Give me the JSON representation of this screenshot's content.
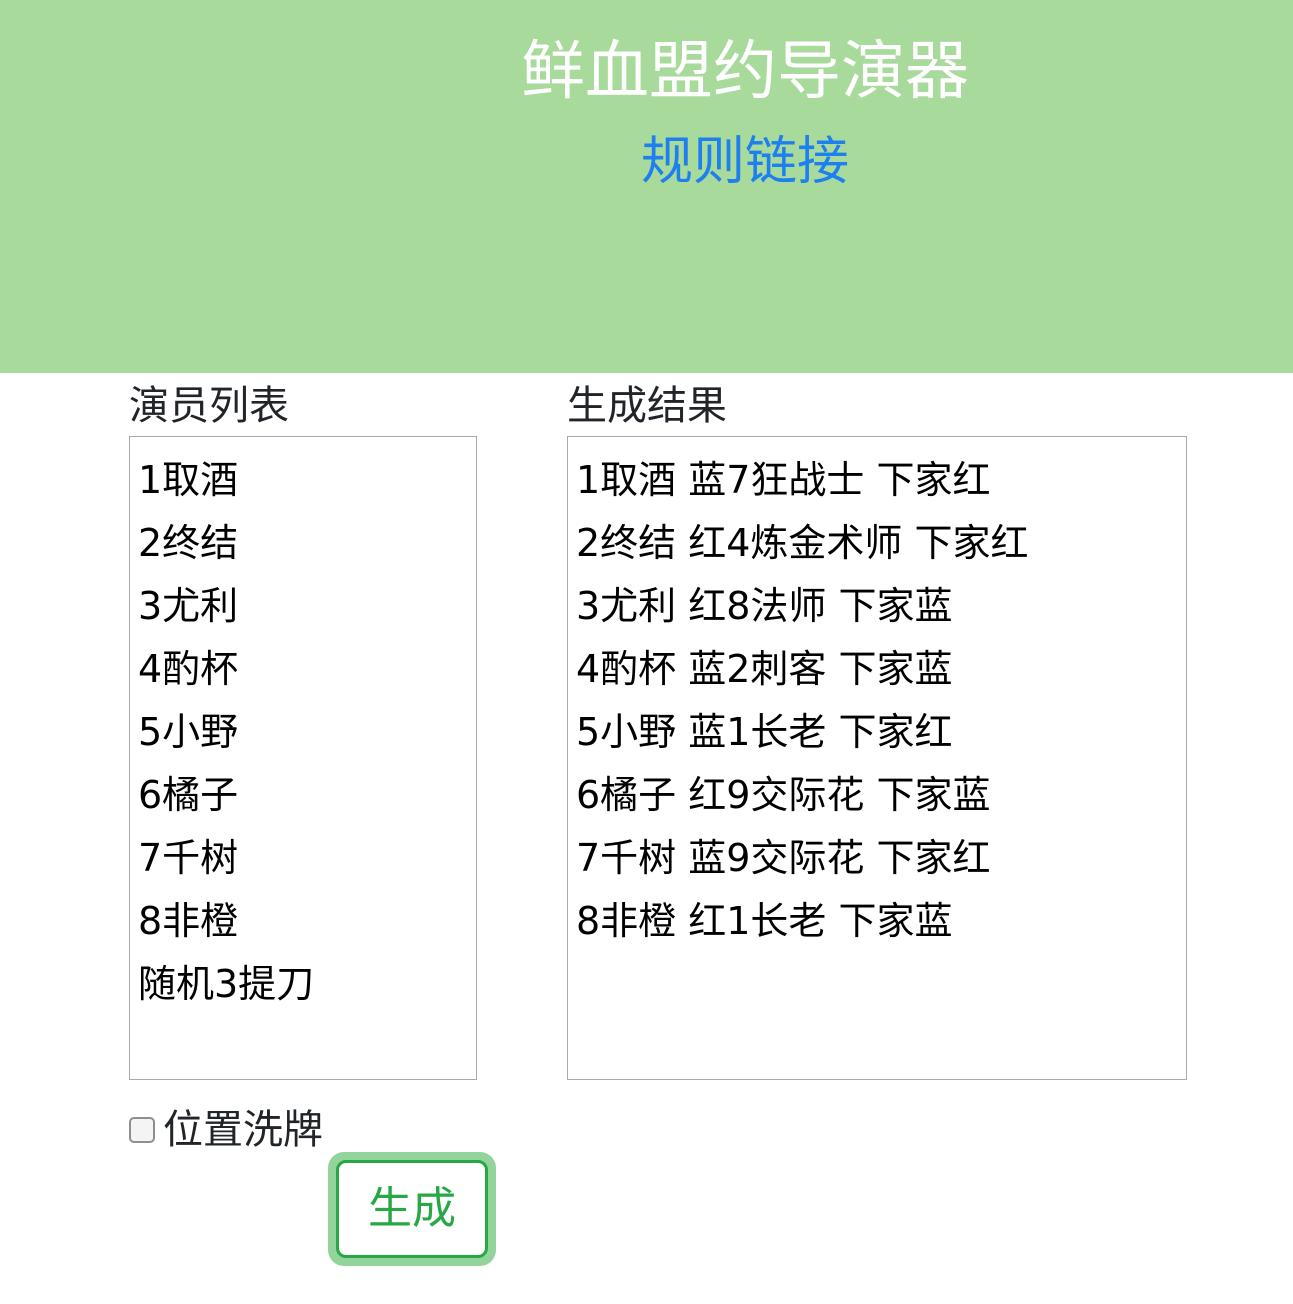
{
  "header": {
    "title": "鲜血盟约导演器",
    "rules_link": "规则链接",
    "background_color": "#a8da9c",
    "link_color": "#1e7ff0"
  },
  "actors_panel": {
    "label": "演员列表",
    "lines": [
      "1取酒",
      "2终结",
      "3尤利",
      "4酌杯",
      "5小野",
      "6橘子",
      "7千树",
      "8非橙",
      "随机3提刀"
    ]
  },
  "result_panel": {
    "label": "生成结果",
    "lines": [
      "1取酒 蓝7狂战士 下家红",
      "2终结 红4炼金术师 下家红",
      "3尤利 红8法师 下家蓝",
      "4酌杯 蓝2刺客 下家蓝",
      "5小野 蓝1长老 下家红",
      "6橘子 红9交际花 下家蓝",
      "7千树 蓝9交际花 下家红",
      "8非橙 红1长老 下家蓝"
    ]
  },
  "options": {
    "shuffle_label": "位置洗牌",
    "shuffle_checked": false
  },
  "actions": {
    "generate_label": "生成",
    "generate_color": "#28a745"
  }
}
